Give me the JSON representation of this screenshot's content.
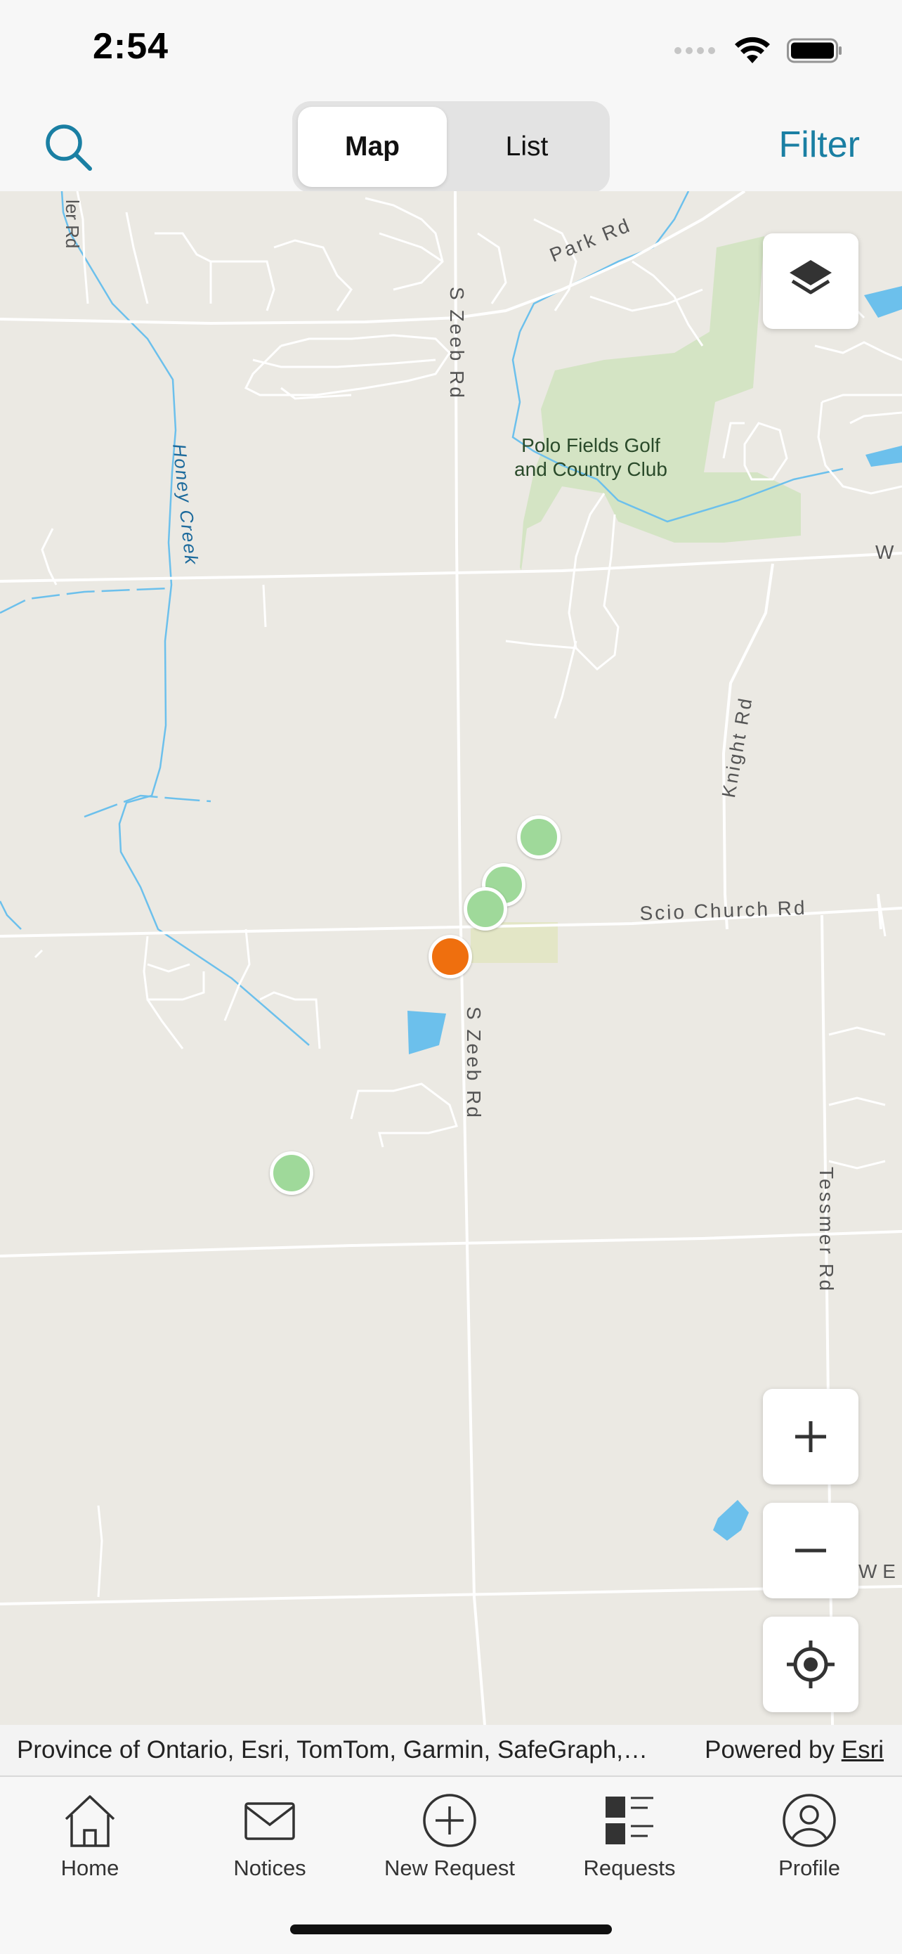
{
  "status_bar": {
    "time": "2:54"
  },
  "nav": {
    "search_icon": "search-icon",
    "segments": [
      {
        "label": "Map",
        "selected": true
      },
      {
        "label": "List",
        "selected": false
      }
    ],
    "filter_label": "Filter"
  },
  "map": {
    "labels": {
      "park_rd": "Park Rd",
      "s_zeeb_rd_top": "S Zeeb Rd",
      "s_zeeb_rd_bottom": "S Zeeb Rd",
      "honey_creek": "Honey Creek",
      "golf_club": "Polo Fields Golf and Country Club",
      "knight_rd": "Knight Rd",
      "scio_church_rd": "Scio Church Rd",
      "tessmer_rd": "Tessmer Rd",
      "wheeler_rd_partial": "ler Rd",
      "w_right_top": "W",
      "w_e_right_bottom": "W E"
    },
    "markers": [
      {
        "status": "green",
        "color": "#9fd99a"
      },
      {
        "status": "green",
        "color": "#9fd99a"
      },
      {
        "status": "green",
        "color": "#9fd99a"
      },
      {
        "status": "orange",
        "color": "#ef6f0e"
      },
      {
        "status": "green",
        "color": "#9fd99a"
      }
    ],
    "controls": {
      "layers_icon": "layers-icon",
      "zoom_in_icon": "plus-icon",
      "zoom_out_icon": "minus-icon",
      "locate_icon": "location-target-icon"
    }
  },
  "attribution": {
    "text": "Province of Ontario, Esri, TomTom, Garmin, SafeGraph,…",
    "powered_by": "Powered by",
    "esri_link": "Esri"
  },
  "tabs": [
    {
      "label": "Home",
      "icon": "home-icon"
    },
    {
      "label": "Notices",
      "icon": "envelope-icon"
    },
    {
      "label": "New Request",
      "icon": "plus-circle-icon"
    },
    {
      "label": "Requests",
      "icon": "list-icon"
    },
    {
      "label": "Profile",
      "icon": "person-icon"
    }
  ],
  "colors": {
    "accent": "#1a7fa3",
    "map_background": "#ebe9e3",
    "golf_green": "#d4e4c4",
    "water": "#6cc0ec",
    "marker_green": "#9fd99a",
    "marker_orange": "#ef6f0e"
  }
}
